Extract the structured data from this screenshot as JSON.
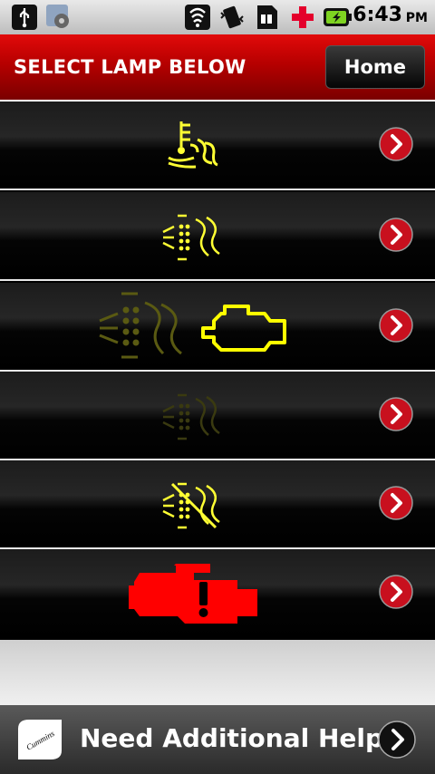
{
  "status_bar": {
    "time": "6:43",
    "ampm": "PM",
    "icons": [
      "usb-icon",
      "settings-icon",
      "wifi-icon",
      "vibrate-icon",
      "sim-icon",
      "health-icon",
      "battery-charging-icon"
    ]
  },
  "header": {
    "title": "SELECT LAMP BELOW",
    "home_label": "Home"
  },
  "lamps": [
    {
      "icon": "exhaust-temperature-lamp-icon",
      "color": "#ffff33"
    },
    {
      "icon": "particulate-filter-lamp-icon",
      "color": "#ffff33"
    },
    {
      "icon": "check-engine-with-filter-lamp-icon",
      "color": "#ffff00"
    },
    {
      "icon": "particulate-filter-dim-lamp-icon",
      "color": "#3a3a10"
    },
    {
      "icon": "filter-disabled-lamp-icon",
      "color": "#ffff33"
    },
    {
      "icon": "stop-engine-lamp-icon",
      "color": "#ff0000"
    }
  ],
  "footer": {
    "help_label": "Need Additional Help?",
    "logo_text": "Cummins"
  }
}
